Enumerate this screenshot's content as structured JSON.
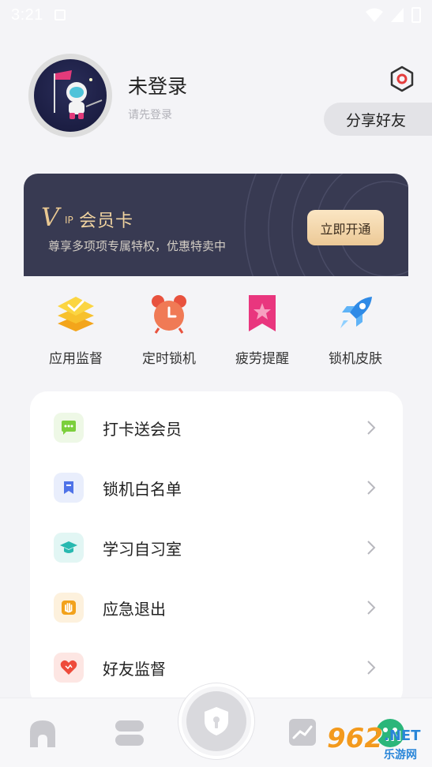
{
  "status_bar": {
    "time": "3:21"
  },
  "profile": {
    "username": "未登录",
    "subtitle": "请先登录",
    "share_label": "分享好友"
  },
  "vip": {
    "logo_letter": "V",
    "logo_ip": "IP",
    "title": "会员卡",
    "description": "尊享多项项专属特权，优惠特卖中",
    "button_label": "立即开通"
  },
  "features": [
    {
      "label": "应用监督",
      "icon": "layers-check-icon"
    },
    {
      "label": "定时锁机",
      "icon": "alarm-clock-icon"
    },
    {
      "label": "疲劳提醒",
      "icon": "bookmark-star-icon"
    },
    {
      "label": "锁机皮肤",
      "icon": "rocket-icon"
    }
  ],
  "menu": [
    {
      "label": "打卡送会员",
      "icon": "chat-bubble-icon",
      "color": "#7ccf3c",
      "bg": "#eef8e6"
    },
    {
      "label": "锁机白名单",
      "icon": "bookmark-icon",
      "color": "#4f73e8",
      "bg": "#e9eefc"
    },
    {
      "label": "学习自习室",
      "icon": "graduation-cap-icon",
      "color": "#28b9b0",
      "bg": "#e2f6f4"
    },
    {
      "label": "应急退出",
      "icon": "hand-icon",
      "color": "#f2a21c",
      "bg": "#fdf1dd"
    },
    {
      "label": "好友监督",
      "icon": "heart-icon",
      "color": "#ee4b3b",
      "bg": "#fde6e3"
    }
  ],
  "watermark": {
    "number": "962",
    "suffix": ".NET",
    "cn": "乐游网"
  },
  "colors": {
    "vip_card": "#383a52",
    "vip_gold": "#e9c892",
    "accent_red": "#ee4b3b"
  }
}
